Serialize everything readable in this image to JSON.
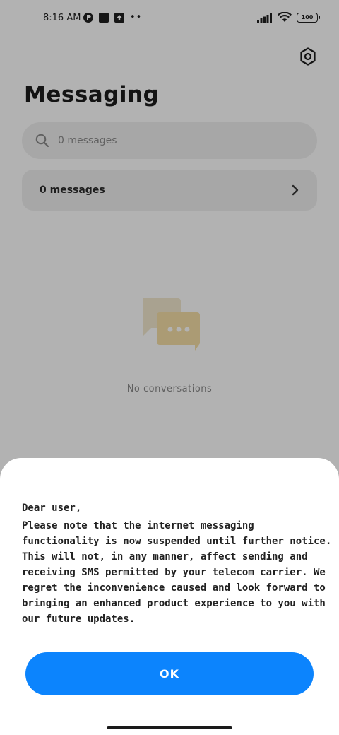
{
  "status_bar": {
    "time": "8:16 AM",
    "left_icons": [
      "pinterest-style-icon",
      "square-app-icon",
      "upload-arrow-icon"
    ],
    "more": "••",
    "battery": "100"
  },
  "header": {
    "title": "Messaging",
    "settings_icon": "gear-hex-icon"
  },
  "search": {
    "placeholder": "0 messages"
  },
  "messages_row": {
    "label": "0 messages"
  },
  "empty_state": {
    "text": "No conversations",
    "colors": {
      "bubble_back": "#f2e8cf",
      "bubble_front": "#f5dfa6"
    }
  },
  "dialog": {
    "greeting": "Dear user,",
    "body": "Please note that the internet messaging functionality is now suspended until further notice. This will not, in any manner, affect sending and receiving SMS permitted by your telecom carrier. We regret the inconvenience caused and look forward to bringing an enhanced product experience to you with our future updates.",
    "ok_label": "OK",
    "accent": "#0c84fd"
  }
}
